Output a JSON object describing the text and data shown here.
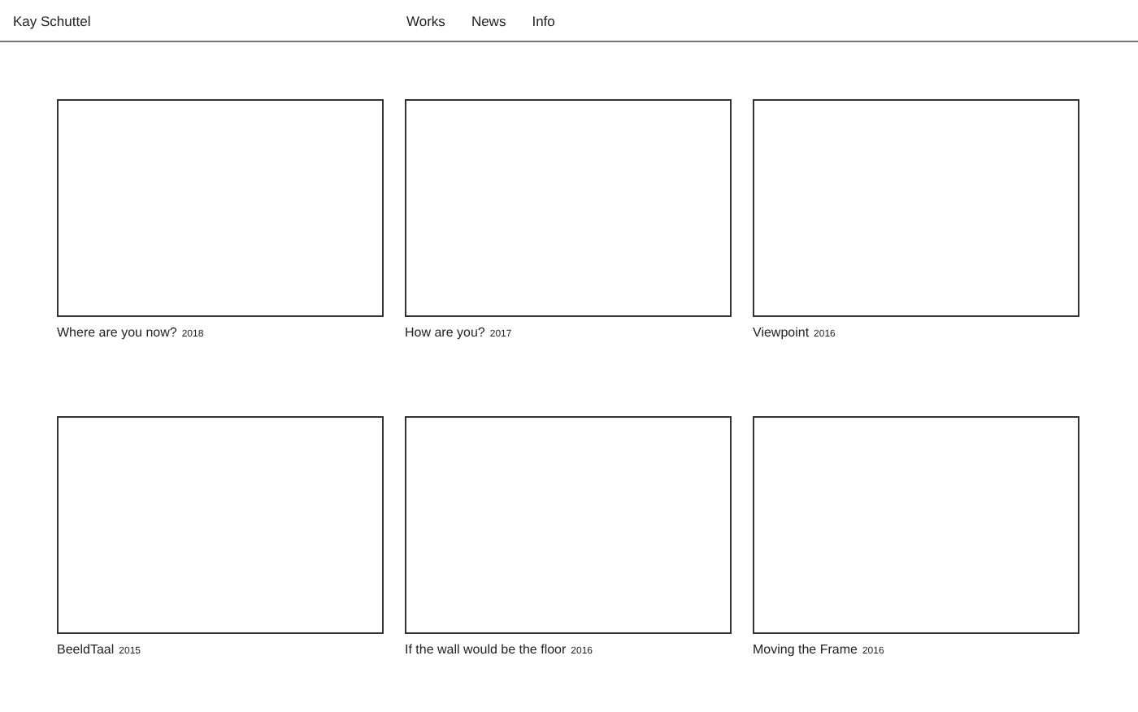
{
  "site_title": "Kay Schuttel",
  "nav": [
    {
      "label": "Works"
    },
    {
      "label": "News"
    },
    {
      "label": "Info"
    }
  ],
  "works": [
    {
      "title": "Where are you now?",
      "year": "2018"
    },
    {
      "title": "How are you?",
      "year": "2017"
    },
    {
      "title": "Viewpoint",
      "year": "2016"
    },
    {
      "title": "BeeldTaal",
      "year": "2015"
    },
    {
      "title": "If the wall would be the floor",
      "year": "2016"
    },
    {
      "title": "Moving the Frame",
      "year": "2016"
    }
  ]
}
